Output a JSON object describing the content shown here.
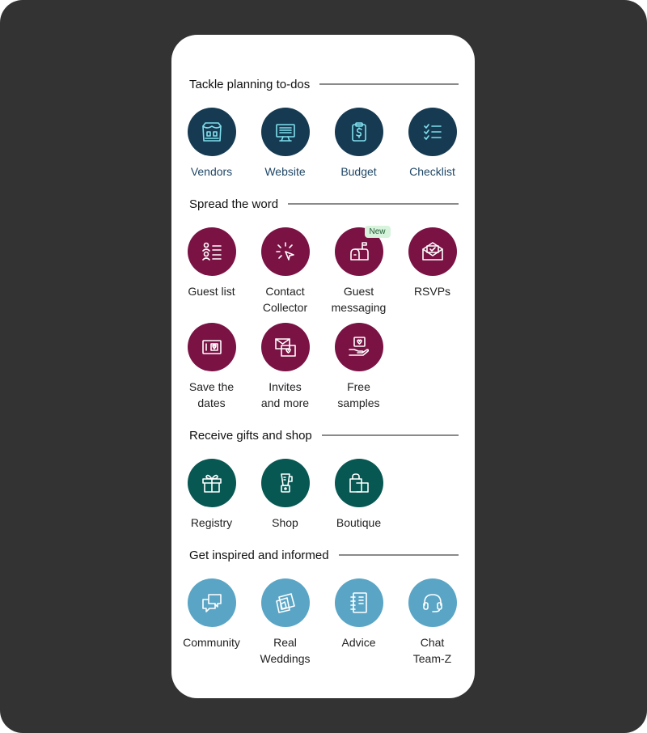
{
  "sections": [
    {
      "title": "Tackle planning to-dos",
      "items": [
        {
          "label": "Vendors",
          "icon": "vendors-store-icon"
        },
        {
          "label": "Website",
          "icon": "monitor-icon"
        },
        {
          "label": "Budget",
          "icon": "budget-clipboard-dollar-icon"
        },
        {
          "label": "Checklist",
          "icon": "checklist-icon"
        }
      ]
    },
    {
      "title": "Spread the word",
      "items": [
        {
          "label1": "Guest list",
          "icon": "guest-list-icon"
        },
        {
          "label1": "Contact",
          "label2": "Collector",
          "icon": "cursor-click-icon"
        },
        {
          "label1": "Guest",
          "label2": "messaging",
          "icon": "mailbox-icon",
          "badge": "New"
        },
        {
          "label1": "RSVPs",
          "icon": "envelope-check-icon"
        },
        {
          "label1": "Save the",
          "label2": "dates",
          "icon": "save-the-date-card-icon"
        },
        {
          "label1": "Invites",
          "label2": "and more",
          "icon": "invites-envelope-icon"
        },
        {
          "label1": "Free",
          "label2": "samples",
          "icon": "hand-heart-icon"
        }
      ]
    },
    {
      "title": "Receive gifts and shop",
      "items": [
        {
          "label": "Registry",
          "icon": "gift-icon"
        },
        {
          "label": "Shop",
          "icon": "blender-icon"
        },
        {
          "label": "Boutique",
          "icon": "shopping-bag-icon"
        }
      ]
    },
    {
      "title": "Get inspired and informed",
      "items": [
        {
          "label": "Community",
          "icon": "chat-bubbles-icon"
        },
        {
          "label1": "Real",
          "label2": "Weddings",
          "icon": "photos-icon"
        },
        {
          "label": "Advice",
          "icon": "notebook-icon"
        },
        {
          "label1": "Chat",
          "label2": "Team-Z",
          "icon": "headset-icon"
        }
      ]
    }
  ],
  "colors": {
    "planning": "#163a52",
    "spread": "#7a1244",
    "gifts": "#075752",
    "inspired": "#5aa5c5",
    "background": "#333333"
  }
}
